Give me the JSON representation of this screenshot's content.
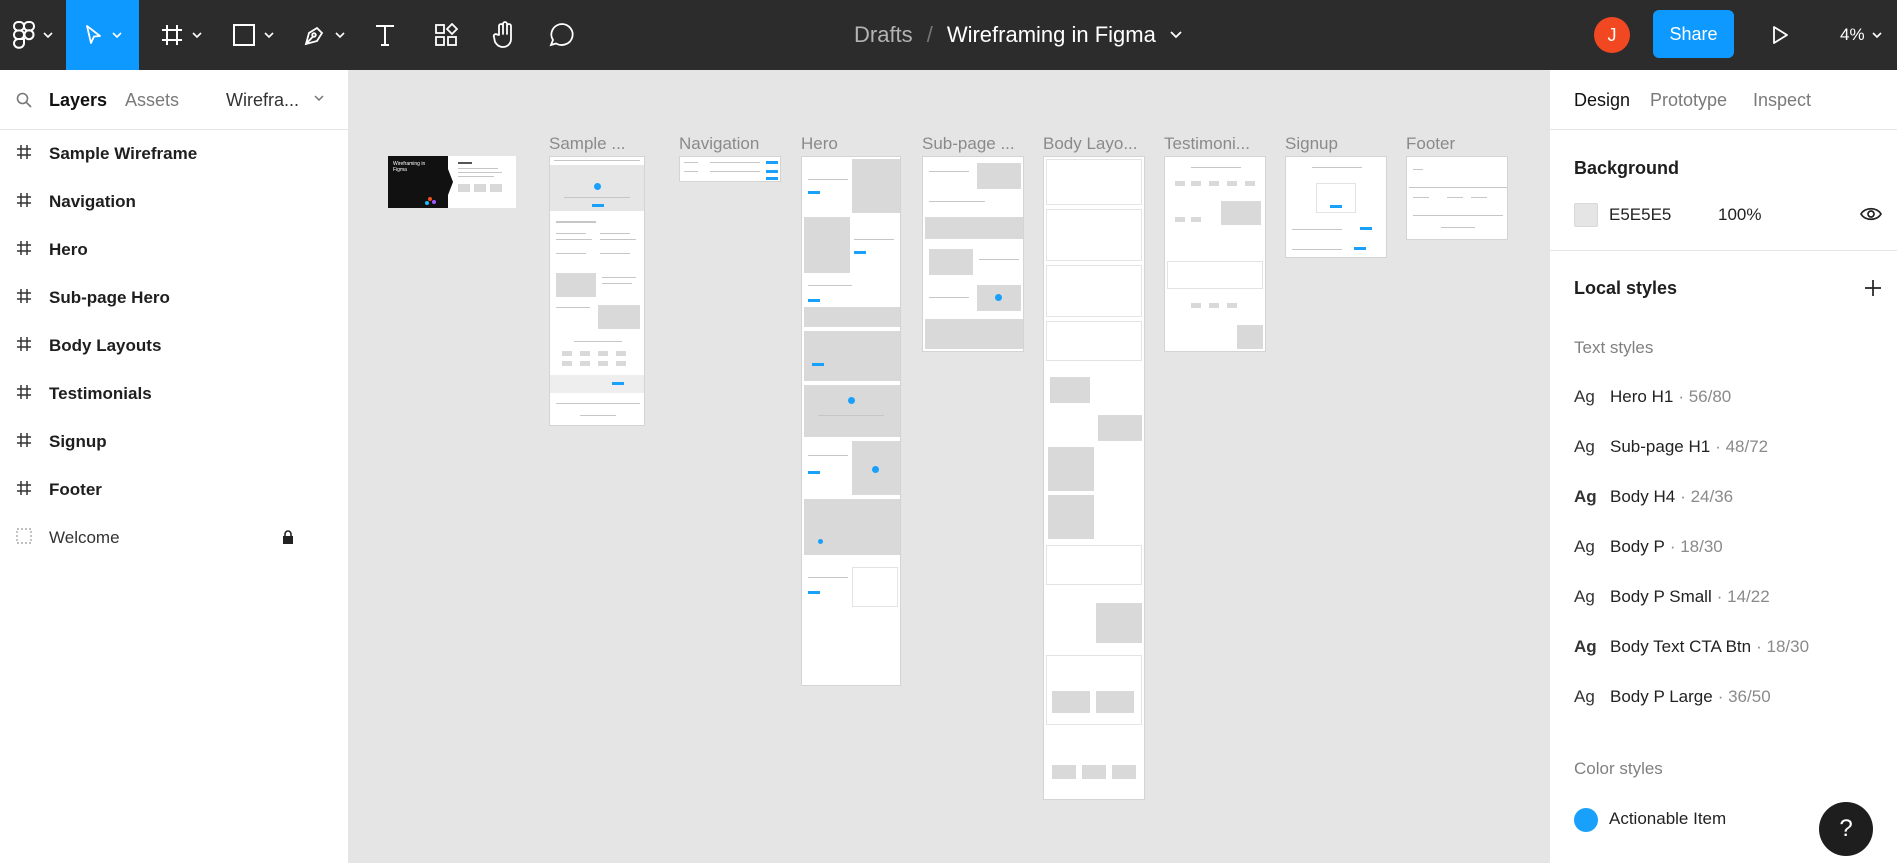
{
  "toolbar": {
    "breadcrumb_parent": "Drafts",
    "breadcrumb_separator": "/",
    "file_name": "Wireframing in Figma",
    "avatar_initial": "J",
    "share_label": "Share",
    "zoom_label": "4%"
  },
  "left_panel": {
    "tabs": [
      "Layers",
      "Assets"
    ],
    "page_selector": "Wirefra...",
    "layers": [
      {
        "label": "Sample Wireframe",
        "icon": "frame-icon"
      },
      {
        "label": "Navigation",
        "icon": "frame-icon"
      },
      {
        "label": "Hero",
        "icon": "frame-icon"
      },
      {
        "label": "Sub-page Hero",
        "icon": "frame-icon"
      },
      {
        "label": "Body Layouts",
        "icon": "frame-icon"
      },
      {
        "label": "Testimonials",
        "icon": "frame-icon"
      },
      {
        "label": "Signup",
        "icon": "frame-icon"
      },
      {
        "label": "Footer",
        "icon": "frame-icon"
      },
      {
        "label": "Welcome",
        "icon": "section-icon",
        "locked": true
      }
    ]
  },
  "canvas": {
    "frame_labels": [
      "Sample ...",
      "Navigation",
      "Hero",
      "Sub-page ...",
      "Body Layo...",
      "Testimoni...",
      "Signup",
      "Footer"
    ],
    "welcome_title": "Wireframing in Figma"
  },
  "right_panel": {
    "tabs": [
      "Design",
      "Prototype",
      "Inspect"
    ],
    "background_title": "Background",
    "background_hex": "E5E5E5",
    "background_opacity": "100%",
    "local_styles_title": "Local styles",
    "text_styles_title": "Text styles",
    "text_styles": [
      {
        "name": "Hero H1",
        "spec": "· 56/80",
        "bold": false
      },
      {
        "name": "Sub-page H1",
        "spec": "· 48/72",
        "bold": false
      },
      {
        "name": "Body H4",
        "spec": "· 24/36",
        "bold": true
      },
      {
        "name": "Body P",
        "spec": "· 18/30",
        "bold": false
      },
      {
        "name": "Body P Small",
        "spec": "· 14/22",
        "bold": false
      },
      {
        "name": "Body Text CTA Btn",
        "spec": "· 18/30",
        "bold": true
      },
      {
        "name": "Body P Large",
        "spec": "· 36/50",
        "bold": false
      }
    ],
    "text_style_glyph": "Ag",
    "color_styles_title": "Color styles",
    "color_styles": [
      {
        "name": "Actionable Item",
        "color": "#18A0FB"
      }
    ]
  },
  "help_label": "?",
  "colors": {
    "accent": "#0d99ff",
    "toolbar": "#2c2c2c",
    "canvas": "#e5e5e5",
    "avatar": "#f24822"
  }
}
